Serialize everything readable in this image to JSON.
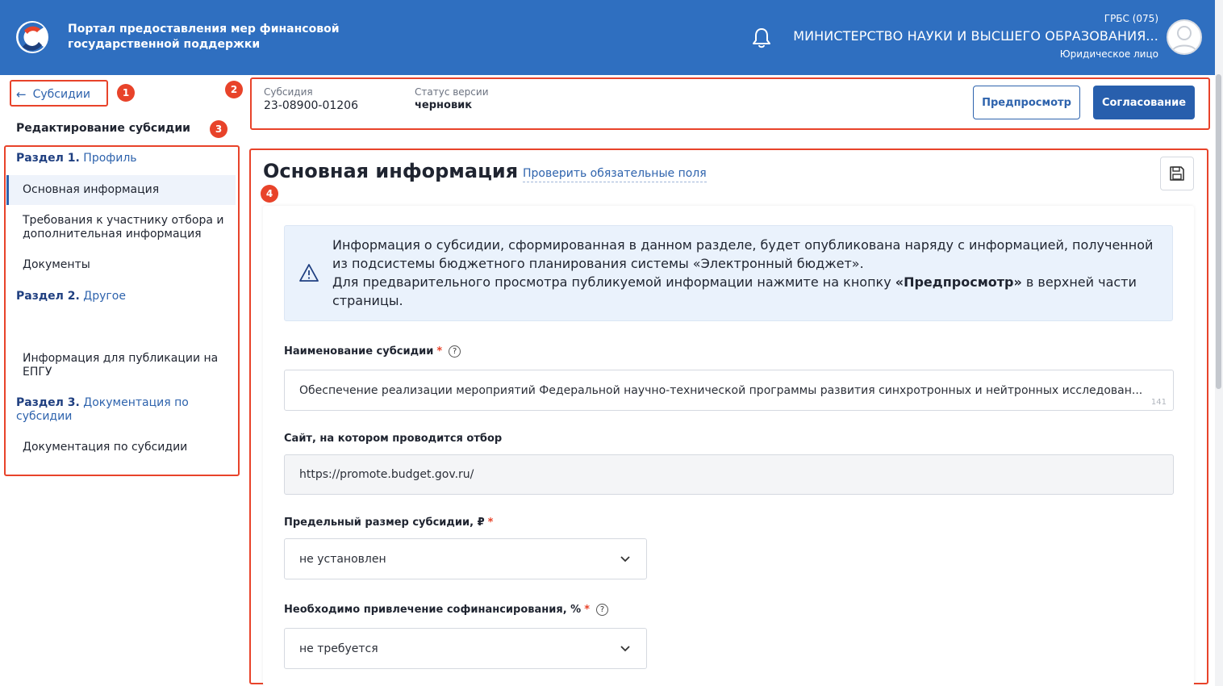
{
  "header": {
    "portal_title_line1": "Портал предоставления мер финансовой",
    "portal_title_line2": "государственной поддержки",
    "grbs": "ГРБС (075)",
    "ministry": "МИНИСТЕРСТВО НАУКИ И ВЫСШЕГО ОБРАЗОВАНИЯ...",
    "entity_type": "Юридическое лицо",
    "brand_color": "#2f6fc0"
  },
  "annotations": [
    "1",
    "2",
    "3",
    "4"
  ],
  "sidebar": {
    "back_label": "Субсидии",
    "edit_title": "Редактирование субсидии",
    "sections": [
      {
        "prefix": "Раздел 1.",
        "name": "Профиль"
      },
      {
        "prefix": "Раздел 2.",
        "name": "Другое"
      },
      {
        "prefix": "Раздел 3.",
        "name": "Документация по субсидии"
      }
    ],
    "items": [
      {
        "label": "Основная информация"
      },
      {
        "label": "Требования к участнику отбора и дополнительная информация"
      },
      {
        "label": "Документы"
      },
      {
        "label": "Информация для публикации на ЕПГУ"
      },
      {
        "label": "Документация по субсидии"
      }
    ]
  },
  "topbar": {
    "subsidy_label": "Субсидия",
    "subsidy_number": "23-08900-01206",
    "status_label": "Статус версии",
    "status_value": "черновик",
    "preview_button": "Предпросмотр",
    "approve_button": "Согласование"
  },
  "main": {
    "title": "Основная информация",
    "check_link": "Проверить обязательные поля",
    "alert_line1": "Информация о субсидии, сформированная в данном разделе, будет опубликована наряду с информацией, полученной из подсистемы бюджетного планирования системы «Электронный бюджет».",
    "alert_line2_pre": "Для предварительного просмотра публикуемой информации нажмите на кнопку ",
    "alert_line2_bold": "«Предпросмотр»",
    "alert_line2_post": " в верхней части страницы.",
    "fields": {
      "name_label": "Наименование субсидии",
      "name_value": "Обеспечение реализации мероприятий Федеральной научно-технической программы развития синхротронных и нейтронных исследован...",
      "name_counter": "141",
      "site_label": "Сайт, на котором проводится отбор",
      "site_value": "https://promote.budget.gov.ru/",
      "limit_label": "Предельный размер субсидии, ₽",
      "limit_value": "не установлен",
      "cofin_label": "Необходимо привлечение софинансирования, %",
      "cofin_value": "не требуется"
    }
  }
}
